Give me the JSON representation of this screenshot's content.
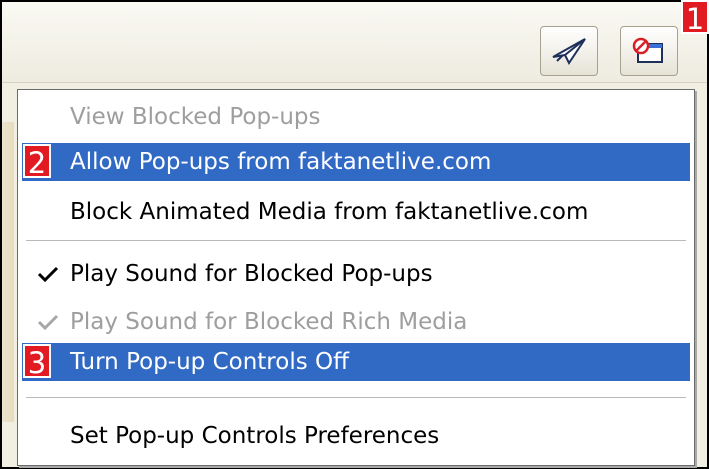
{
  "callouts": [
    "1",
    "2",
    "3"
  ],
  "toolbar": {
    "buttons": [
      {
        "icon": "paper-plane-icon"
      },
      {
        "icon": "popup-blocked-icon"
      }
    ]
  },
  "menu": {
    "items": [
      {
        "label": "View Blocked Pop-ups",
        "state": "disabled"
      },
      {
        "label": "Allow Pop-ups from faktanetlive.com",
        "state": "selected"
      },
      {
        "label": "Block Animated Media from faktanetlive.com",
        "state": "normal"
      },
      {
        "label": "Play Sound for Blocked Pop-ups",
        "state": "checked"
      },
      {
        "label": "Play Sound for Blocked Rich Media",
        "state": "disabled-checked"
      },
      {
        "label": "Turn Pop-up Controls Off",
        "state": "selected"
      },
      {
        "label": "Set Pop-up Controls Preferences",
        "state": "normal"
      }
    ]
  },
  "colors": {
    "selection": "#316ac5",
    "callout": "#e21b23",
    "disabled_text": "#9e9e9e"
  }
}
